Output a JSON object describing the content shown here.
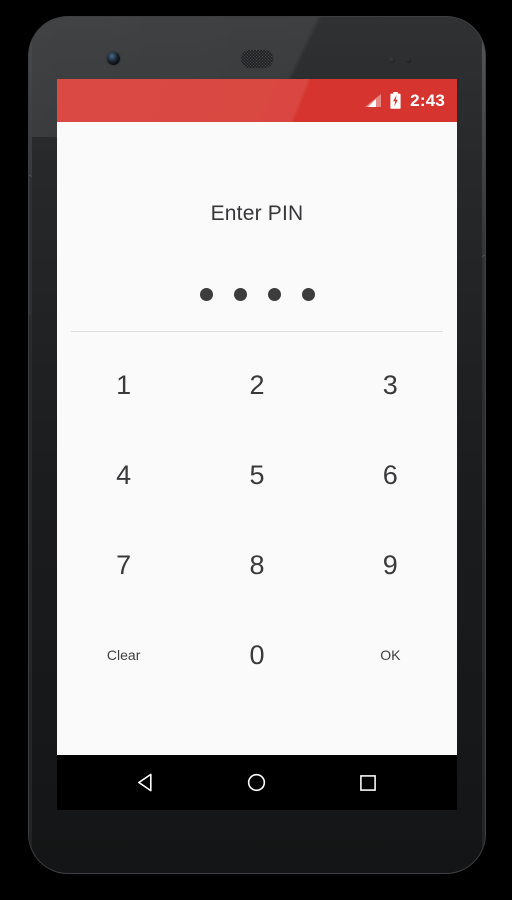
{
  "device": {
    "hardware": {
      "front_camera": "front-camera",
      "earpiece": "earpiece-speaker",
      "proximity_sensor": "proximity-sensor",
      "light_sensor": "light-sensor",
      "volume_rocker": "volume-rocker",
      "power_button": "power-button"
    }
  },
  "status_bar": {
    "time": "2:43",
    "background_color": "#d6352f",
    "signal_icon": "signal-triangle-icon",
    "battery_icon": "battery-charging-icon"
  },
  "screen": {
    "background_color": "#fafafa"
  },
  "pin_screen": {
    "title": "Enter PIN",
    "entered_count": 4,
    "dot_total": 4,
    "dot_color": "#3c3c3c",
    "divider_color": "#dedede"
  },
  "keypad": {
    "keys": [
      {
        "label": "1",
        "name": "key-1",
        "type": "digit"
      },
      {
        "label": "2",
        "name": "key-2",
        "type": "digit"
      },
      {
        "label": "3",
        "name": "key-3",
        "type": "digit"
      },
      {
        "label": "4",
        "name": "key-4",
        "type": "digit"
      },
      {
        "label": "5",
        "name": "key-5",
        "type": "digit"
      },
      {
        "label": "6",
        "name": "key-6",
        "type": "digit"
      },
      {
        "label": "7",
        "name": "key-7",
        "type": "digit"
      },
      {
        "label": "8",
        "name": "key-8",
        "type": "digit"
      },
      {
        "label": "9",
        "name": "key-9",
        "type": "digit"
      },
      {
        "label": "Clear",
        "name": "key-clear",
        "type": "word"
      },
      {
        "label": "0",
        "name": "key-0",
        "type": "digit"
      },
      {
        "label": "OK",
        "name": "key-ok",
        "type": "word"
      }
    ]
  },
  "nav_bar": {
    "background_color": "#000000",
    "buttons": [
      {
        "name": "nav-back-button",
        "icon": "back-triangle-icon"
      },
      {
        "name": "nav-home-button",
        "icon": "home-circle-icon"
      },
      {
        "name": "nav-recents-button",
        "icon": "recents-square-icon"
      }
    ]
  }
}
